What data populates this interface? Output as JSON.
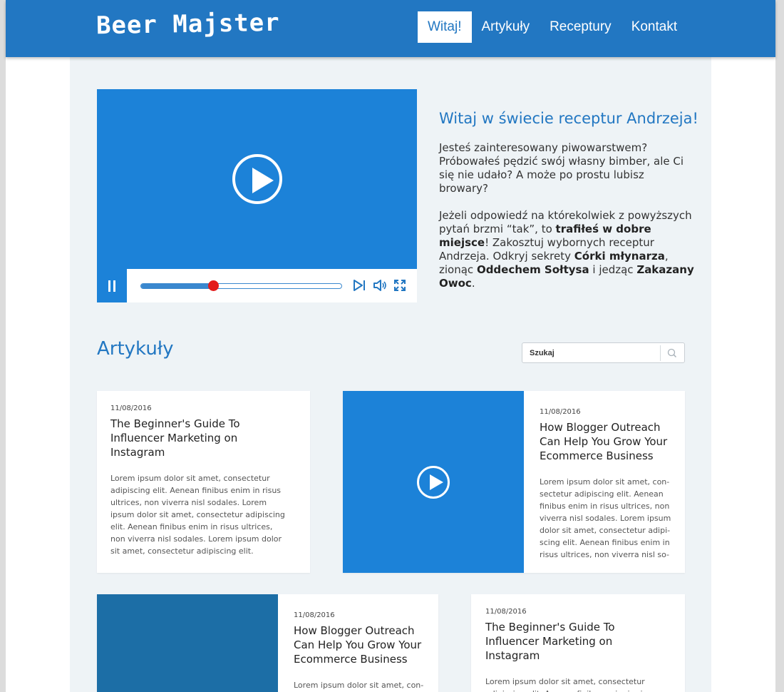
{
  "header": {
    "logo": "Beer Majster",
    "nav": [
      "Witaj!",
      "Artykuły",
      "Receptury",
      "Kontakt"
    ]
  },
  "hero": {
    "title": "Witaj w świecie receptur Andrzeja!",
    "p1": "Jesteś zainteresowany piwowarstwem? Próbowałeś pędzić swój własny bimber, ale Ci się nie udało? A może po prostu lubisz browary?",
    "p2": {
      "t1": "Jeżeli odpowiedź na którekolwiek z powyższych pytań brzmi “tak”, to ",
      "b1": "trafiłeś w dobre miejsce",
      "t2": "! Zakosztuj wybornych receptur Andrzeja. Odkryj sekrety ",
      "b2": "Córki młynarza",
      "t3": ", zionąc ",
      "b3": "Oddechem Sołtysa",
      "t4": " i jedząc ",
      "b4": "Zakazany Owoc",
      "t5": "."
    },
    "video": {
      "progress": 0.36
    }
  },
  "articles": {
    "title": "Artykuły",
    "search_placeholder": "Szukaj",
    "cards": [
      {
        "date": "11/08/2016",
        "title": "The Beginner's Guide To Influencer Marketing on Instagram",
        "excerpt": "Lorem ipsum dolor sit amet, consectetur adipiscing elit. Aenean finibus enim in risus ultrices, non viverra nisl sodales. Lorem ipsum dolor sit amet, consectetur adipiscing elit. Aenean finibus enim in risus ultrices, non viverra nisl sodales. Lorem ipsum dolor sit amet, consectetur adipiscing elit. Aenean"
      },
      {
        "date": "11/08/2016",
        "title": "How Blogger Outreach Can Help You Grow Your Ecommerce Business",
        "excerpt": "Lorem ipsum dolor sit amet, con-sectetur adipiscing elit. Aenean finibus enim in risus ultrices, non viverra nisl sodales. Lorem ipsum dolor sit amet, consectetur adipi-scing elit. Aenean finibus enim in risus ultrices, non viverra nisl so-"
      },
      {
        "date": "11/08/2016",
        "title": "How Blogger Outreach Can Help You Grow Your Ecommerce Business",
        "excerpt": "Lorem ipsum dolor sit amet, con-sectetur adipiscing elit. Aenean"
      },
      {
        "date": "11/08/2016",
        "title": "The Beginner's Guide To Influencer Marketing on Instagram",
        "excerpt": "Lorem ipsum dolor sit amet, consectetur adipiscing elit. Aenean finibus enim in risus"
      }
    ]
  },
  "colors": {
    "brand": "#2277c2",
    "video": "#1c82d8",
    "image_dark": "#1c6ea6",
    "progress_knob": "#e31b1b"
  }
}
